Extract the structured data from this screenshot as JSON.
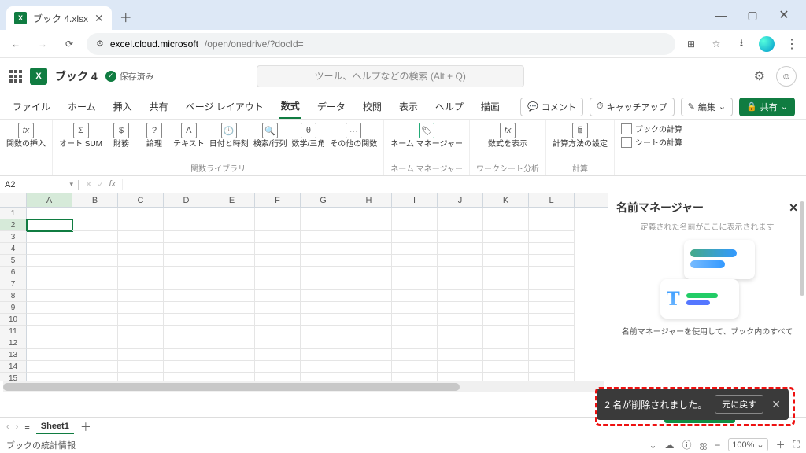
{
  "browser": {
    "tab_title": "ブック 4.xlsx",
    "url_host": "excel.cloud.microsoft",
    "url_path": "/open/onedrive/?docId="
  },
  "app": {
    "doc_title": "ブック 4",
    "saved_label": "保存済み",
    "search_placeholder": "ツール、ヘルプなどの検索 (Alt + Q)"
  },
  "tabs": {
    "items": [
      "ファイル",
      "ホーム",
      "挿入",
      "共有",
      "ページ レイアウト",
      "数式",
      "データ",
      "校閲",
      "表示",
      "ヘルプ",
      "描画"
    ],
    "active_index": 5,
    "actions": {
      "comment": "コメント",
      "catchup": "キャッチアップ",
      "edit": "編集",
      "share": "共有"
    }
  },
  "ribbon": {
    "insert_fn": "関数の挿入",
    "library": {
      "autosum": "オート\nSUM",
      "financial": "財務",
      "logical": "論理",
      "text": "テキスト",
      "date": "日付と時刻",
      "lookup": "検索/行列",
      "math": "数学/三角",
      "more": "その他の関数",
      "group": "関数ライブラリ"
    },
    "name_mgr": {
      "btn": "ネーム\nマネージャー",
      "group": "ネーム マネージャー"
    },
    "show_formulas": {
      "btn": "数式を表示",
      "group": "ワークシート分析"
    },
    "calc": {
      "options": "計算方法の設定",
      "book": "ブックの計算",
      "sheet": "シートの計算",
      "group": "計算"
    }
  },
  "cellref": "A2",
  "grid": {
    "columns": [
      "A",
      "B",
      "C",
      "D",
      "E",
      "F",
      "G",
      "H",
      "I",
      "J",
      "K",
      "L"
    ],
    "rows": [
      1,
      2,
      3,
      4,
      5,
      6,
      7,
      8,
      9,
      10,
      11,
      12,
      13,
      14,
      15
    ],
    "active_col": 0,
    "active_row": 1
  },
  "panel": {
    "title": "名前マネージャー",
    "subtitle": "定義された名前がここに表示されます",
    "desc": "名前マネージャーを使用して、ブック内のすべて"
  },
  "toast": {
    "message": "2 名が削除されました。",
    "undo": "元に戻す"
  },
  "sheet": {
    "name": "Sheet1"
  },
  "status": {
    "left": "ブックの統計情報",
    "zoom": "100%"
  }
}
